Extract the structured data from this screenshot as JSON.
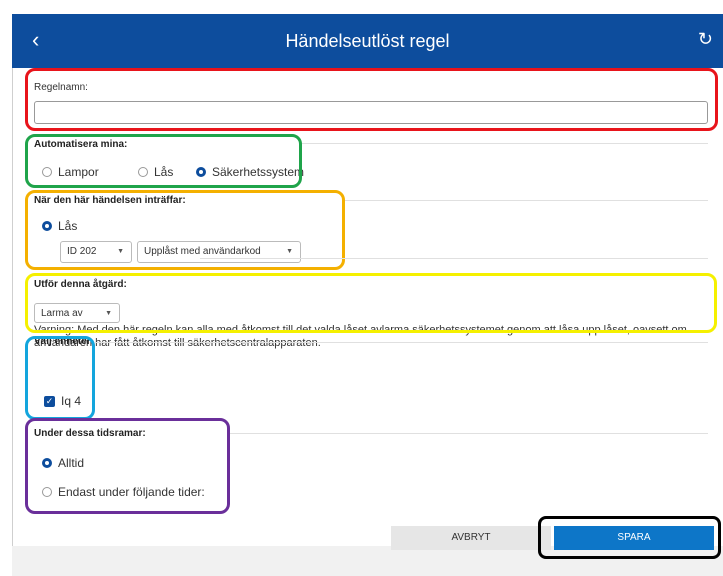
{
  "header": {
    "back_icon": "‹",
    "title": "Händelseutlöst regel",
    "refresh_icon": "↻"
  },
  "rule_name": {
    "label": "Regelnamn:",
    "value": ""
  },
  "automate": {
    "label": "Automatisera mina:",
    "options": [
      {
        "label": "Lampor",
        "selected": false
      },
      {
        "label": "Lås",
        "selected": false
      },
      {
        "label": "Säkerhetssystem",
        "selected": true
      }
    ]
  },
  "trigger": {
    "label": "När den här händelsen inträffar:",
    "option": "Lås",
    "device_select": "ID 202",
    "event_select": "Upplåst med användarkod"
  },
  "action": {
    "label": "Utför denna åtgärd:",
    "select": "Larma av",
    "warning": "Varning: Med den här regeln kan alla med åtkomst till det valda låset avlarma säkerhetssystemet genom att låsa upp låset, oavsett om användaren har fått åtkomst till säkerhetscentralapparaten."
  },
  "units": {
    "label": "Välj enheter",
    "items": [
      {
        "label": "Iq 4",
        "checked": true
      }
    ]
  },
  "time": {
    "label": "Under dessa tidsramar:",
    "options": [
      {
        "label": "Alltid",
        "selected": true
      },
      {
        "label": "Endast under följande tider:",
        "selected": false
      }
    ]
  },
  "buttons": {
    "cancel": "AVBRYT",
    "save": "SPARA"
  },
  "colors": {
    "header": "#0d4d9d",
    "red": "#e8141b",
    "green": "#1fa44a",
    "orange": "#f4b000",
    "yellow": "#f5f000",
    "cyan": "#13a5dd",
    "purple": "#6a2f9a",
    "black": "#000000"
  }
}
